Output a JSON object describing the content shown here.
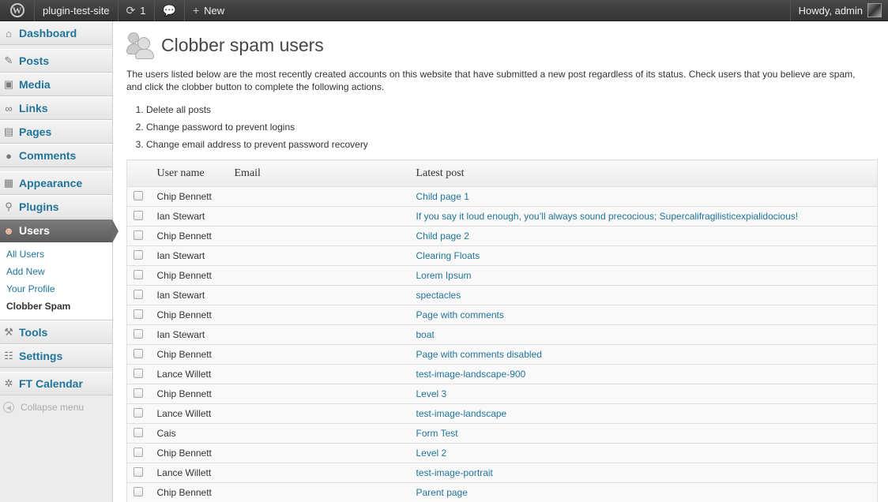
{
  "adminbar": {
    "site_name": "plugin-test-site",
    "updates_count": "1",
    "new_label": "New",
    "howdy": "Howdy, admin"
  },
  "sidebar": {
    "items": [
      {
        "label": "Dashboard",
        "icon": "dashboard-icon"
      },
      {
        "label": "Posts",
        "icon": "pin-icon"
      },
      {
        "label": "Media",
        "icon": "media-icon"
      },
      {
        "label": "Links",
        "icon": "link-icon"
      },
      {
        "label": "Pages",
        "icon": "pages-icon"
      },
      {
        "label": "Comments",
        "icon": "comment-icon"
      },
      {
        "label": "Appearance",
        "icon": "appearance-icon"
      },
      {
        "label": "Plugins",
        "icon": "plugin-icon"
      },
      {
        "label": "Users",
        "icon": "users-icon"
      },
      {
        "label": "Tools",
        "icon": "tools-icon"
      },
      {
        "label": "Settings",
        "icon": "settings-icon"
      },
      {
        "label": "FT Calendar",
        "icon": "calendar-icon"
      }
    ],
    "users_submenu": [
      "All Users",
      "Add New",
      "Your Profile",
      "Clobber Spam"
    ],
    "collapse_label": "Collapse menu"
  },
  "page": {
    "title": "Clobber spam users",
    "intro": "The users listed below are the most recently created accounts on this website that have submitted a new post regardless of its status. Check users that you believe are spam, and click the clobber button to complete the following actions.",
    "actions": [
      "Delete all posts",
      "Change password to prevent logins",
      "Change email address to prevent password recovery"
    ]
  },
  "table": {
    "headers": {
      "username": "User name",
      "email": "Email",
      "latest_post": "Latest post"
    },
    "rows": [
      {
        "username": "Chip Bennett",
        "email": "",
        "latest_post": "Child page 1"
      },
      {
        "username": "Ian Stewart",
        "email": "",
        "latest_post": "If you say it loud enough, you’ll always sound precocious; Supercalifragilisticexpialidocious!"
      },
      {
        "username": "Chip Bennett",
        "email": "",
        "latest_post": "Child page 2"
      },
      {
        "username": "Ian Stewart",
        "email": "",
        "latest_post": "Clearing Floats"
      },
      {
        "username": "Chip Bennett",
        "email": "",
        "latest_post": "Lorem Ipsum"
      },
      {
        "username": "Ian Stewart",
        "email": "",
        "latest_post": "spectacles"
      },
      {
        "username": "Chip Bennett",
        "email": "",
        "latest_post": "Page with comments"
      },
      {
        "username": "Ian Stewart",
        "email": "",
        "latest_post": "boat"
      },
      {
        "username": "Chip Bennett",
        "email": "",
        "latest_post": "Page with comments disabled"
      },
      {
        "username": "Lance Willett",
        "email": "",
        "latest_post": "test-image-landscape-900"
      },
      {
        "username": "Chip Bennett",
        "email": "",
        "latest_post": "Level 3"
      },
      {
        "username": "Lance Willett",
        "email": "",
        "latest_post": "test-image-landscape"
      },
      {
        "username": "Cais",
        "email": "",
        "latest_post": "Form Test"
      },
      {
        "username": "Chip Bennett",
        "email": "",
        "latest_post": "Level 2"
      },
      {
        "username": "Lance Willett",
        "email": "",
        "latest_post": "test-image-portrait"
      },
      {
        "username": "Chip Bennett",
        "email": "",
        "latest_post": "Parent page"
      }
    ]
  }
}
